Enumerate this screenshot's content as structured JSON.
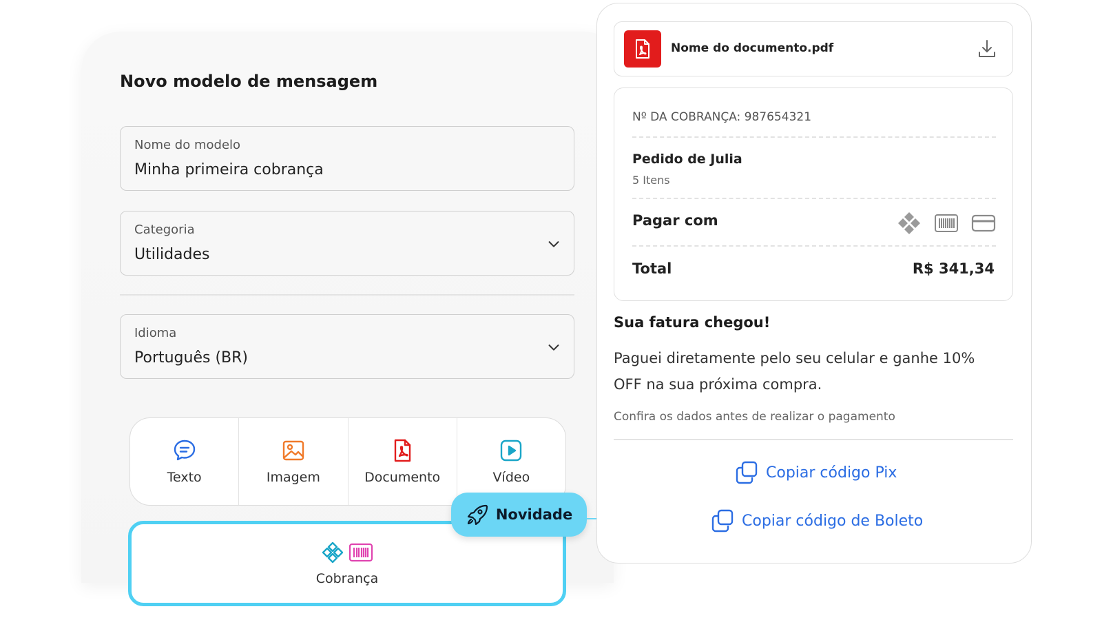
{
  "form": {
    "title": "Novo modelo de mensagem",
    "name_field": {
      "label": "Nome do modelo",
      "value": "Minha primeira cobrança"
    },
    "category_field": {
      "label": "Categoria",
      "value": "Utilidades"
    },
    "language_field": {
      "label": "Idioma",
      "value": "Português (BR)"
    },
    "types": [
      {
        "label": "Texto",
        "icon": "chat-bubble-icon",
        "color": "#2b6de3"
      },
      {
        "label": "Imagem",
        "icon": "image-icon",
        "color": "#f07a2a"
      },
      {
        "label": "Documento",
        "icon": "pdf-icon",
        "color": "#e21c1c"
      },
      {
        "label": "Vídeo",
        "icon": "play-icon",
        "color": "#1aa6c8"
      }
    ],
    "billing_type": {
      "label": "Cobrança",
      "icons": [
        "pix-icon",
        "barcode-icon"
      ]
    },
    "badge": {
      "label": "Novidade",
      "icon": "rocket-icon"
    }
  },
  "preview": {
    "document": {
      "name": "Nome do documento.pdf"
    },
    "bill": {
      "number_label": "Nº DA COBRANÇA: 987654321",
      "order_title": "Pedido de Julia",
      "items_count": "5 Itens",
      "pay_with_label": "Pagar com",
      "pay_methods": [
        "pix-icon",
        "barcode-icon",
        "credit-card-icon"
      ],
      "total_label": "Total",
      "total_value": "R$ 341,34"
    },
    "message": {
      "title": "Sua fatura chegou!",
      "body": "Paguei diretamente pelo seu celular e ganhe 10% OFF na sua próxima compra.",
      "note": "Confira os dados antes de realizar o pagamento"
    },
    "actions": {
      "copy_pix": "Copiar código Pix",
      "copy_boleto": "Copiar código de Boleto"
    }
  },
  "colors": {
    "accent": "#4fd0f3",
    "link": "#2b6de3",
    "pdf_red": "#e21c1c",
    "barcode_pink": "#e044b0"
  }
}
